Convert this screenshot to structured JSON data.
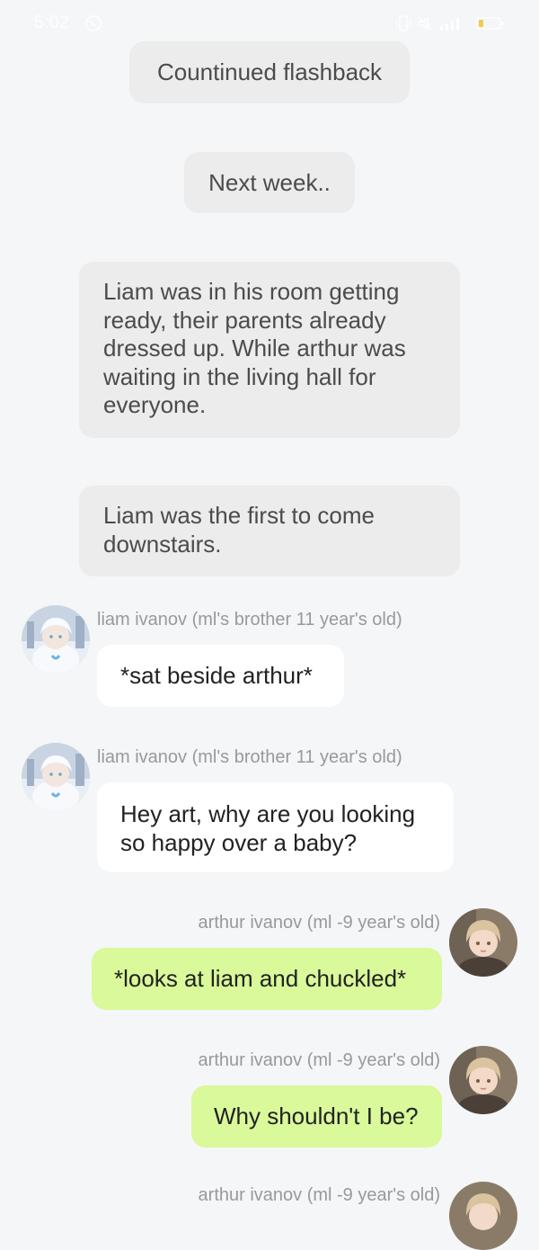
{
  "status_bar": {
    "time": "5:02"
  },
  "messages": [
    {
      "type": "narration",
      "text": "Countinued flashback"
    },
    {
      "type": "narration",
      "text": "Next week.."
    },
    {
      "type": "narration",
      "text": "Liam was in his room getting ready, their parents already dressed up. While arthur was waiting in the living hall for everyone."
    },
    {
      "type": "narration",
      "text": "Liam was the first to come downstairs."
    },
    {
      "type": "incoming",
      "sender": "liam ivanov (ml's brother 11 year's old)",
      "text": "*sat beside arthur*"
    },
    {
      "type": "incoming",
      "sender": "liam ivanov (ml's brother 11 year's old)",
      "text": "Hey art, why are you looking so happy over a baby?"
    },
    {
      "type": "outgoing",
      "sender": "arthur ivanov (ml -9 year's old)",
      "text": "*looks at liam and chuckled*"
    },
    {
      "type": "outgoing",
      "sender": "arthur ivanov (ml -9 year's old)",
      "text": "Why shouldn't I be?"
    },
    {
      "type": "outgoing",
      "sender": "arthur ivanov (ml -9 year's old)",
      "text": ""
    }
  ],
  "colors": {
    "background": "#f5f6f8",
    "narration_bubble": "#ececec",
    "incoming_bubble": "#ffffff",
    "outgoing_bubble": "#d9f99a",
    "sender_text": "#999999"
  },
  "icons": {
    "liam_avatar": "liam-avatar-image",
    "arthur_avatar": "arthur-avatar-image"
  }
}
